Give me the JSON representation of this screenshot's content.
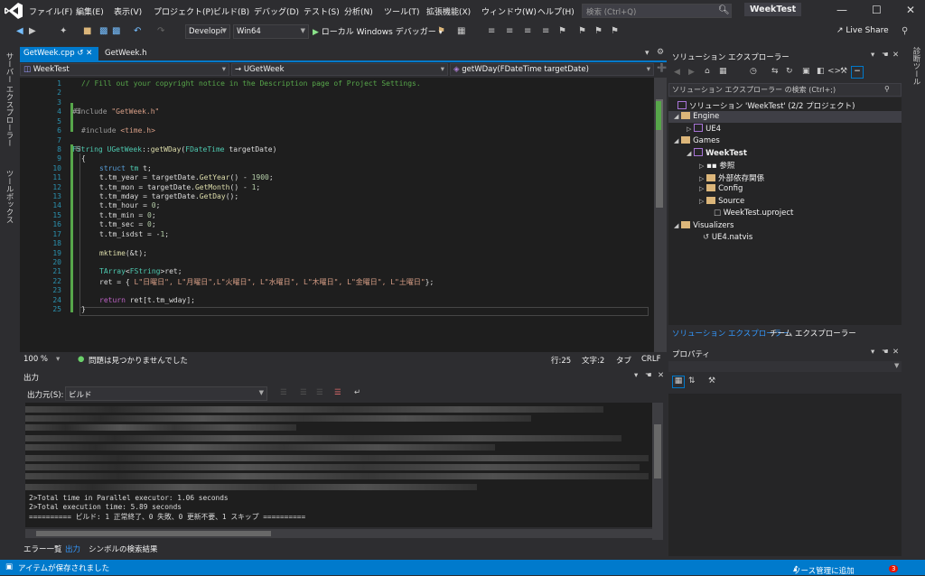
{
  "menu": {
    "items": [
      "ファイル(F)",
      "編集(E)",
      "表示(V)",
      "プロジェクト(P)",
      "ビルド(B)",
      "デバッグ(D)",
      "テスト(S)",
      "分析(N)",
      "ツール(T)",
      "拡張機能(X)",
      "ウィンドウ(W)",
      "ヘルプ(H)"
    ],
    "search_placeholder": "検索 (Ctrl+Q)",
    "solution_name": "WeekTest"
  },
  "toolbar": {
    "config": "Developi",
    "platform": "Win64",
    "run_label": "ローカル Windows デバッガー",
    "live_share": "Live Share"
  },
  "left_strip": {
    "server_explorer": "サーバー エクスプローラー",
    "toolbox": "ツールボックス"
  },
  "right_strip": {
    "diagnostic_tools": "診断ツール"
  },
  "editor": {
    "tabs": [
      "GetWeek.cpp",
      "GetWeek.h"
    ],
    "nav": {
      "project": "WeekTest",
      "class": "UGetWeek",
      "member": "getWDay(FDateTime targetDate)"
    },
    "line_numbers": [
      "1",
      "2",
      "3",
      "4",
      "5",
      "6",
      "7",
      "8",
      "9",
      "10",
      "11",
      "12",
      "13",
      "14",
      "15",
      "16",
      "17",
      "18",
      "19",
      "20",
      "21",
      "22",
      "23",
      "24",
      "25"
    ],
    "lines": {
      "l1": "// Fill out your copyright notice in the Description page of Project Settings.",
      "l4a": "#include ",
      "l4b": "\"GetWeek.h\"",
      "l6a": "#include ",
      "l6b": "<time.h>",
      "l8a": "FString ",
      "l8b": "UGetWeek",
      "l8c": "::",
      "l8d": "getWDay",
      "l8e": "(",
      "l8f": "FDateTime",
      "l8g": " targetDate)",
      "l9": "{",
      "l10a": "struct ",
      "l10b": "tm",
      "l10c": " t;",
      "l11a": "t.tm_year = targetDate.",
      "l11b": "GetYear",
      "l11c": "() - ",
      "l11d": "1900",
      "l11e": ";",
      "l12a": "t.tm_mon = targetDate.",
      "l12b": "GetMonth",
      "l12c": "() - ",
      "l12d": "1",
      "l12e": ";",
      "l13a": "t.tm_mday = targetDate.",
      "l13b": "GetDay",
      "l13c": "();",
      "l14a": "t.tm_hour = ",
      "l14b": "0",
      "l14c": ";",
      "l15a": "t.tm_min = ",
      "l15b": "0",
      "l15c": ";",
      "l16a": "t.tm_sec = ",
      "l16b": "0",
      "l16c": ";",
      "l17a": "t.tm_isdst = -",
      "l17b": "1",
      "l17c": ";",
      "l19a": "mktime",
      "l19b": "(&t);",
      "l21a": "TArray",
      "l21b": "<",
      "l21c": "FString",
      "l21d": ">ret;",
      "l22a": "ret = { ",
      "l22b": "L\"日曜日\", L\"月曜日\",L\"火曜日\", L\"水曜日\", L\"木曜日\", L\"金曜日\", L\"土曜日\"",
      "l22c": "};",
      "l24a": "return ",
      "l24b": "ret[t.tm_wday];",
      "l25": "}"
    },
    "status": {
      "zoom": "100 %",
      "issues": "問題は見つかりませんでした",
      "line": "行:25",
      "col": "文字:2",
      "tab": "タブ",
      "eol": "CRLF"
    }
  },
  "output": {
    "title": "出力",
    "source_label": "出力元(S):",
    "source_value": "ビルド",
    "lines": [
      "2>Total time in Parallel executor: 1.06 seconds",
      "2>Total execution time: 5.89 seconds",
      "========== ビルド: 1 正常終了、0 失敗、0 更新不要、1 スキップ =========="
    ],
    "tabs": [
      "エラー一覧",
      "出力",
      "シンボルの検索結果"
    ]
  },
  "solution_explorer": {
    "title": "ソリューション エクスプローラー",
    "search_placeholder": "ソリューション エクスプローラー の検索 (Ctrl+;)",
    "solution": "ソリューション 'WeekTest' (2/2 プロジェクト)",
    "tree": {
      "engine": "Engine",
      "ue4": "UE4",
      "games": "Games",
      "weektest": "WeekTest",
      "refs": "参照",
      "extdeps": "外部依存関係",
      "config": "Config",
      "source": "Source",
      "uproject": "WeekTest.uproject",
      "visualizers": "Visualizers",
      "natvis": "UE4.natvis"
    },
    "tabs": [
      "ソリューション エクスプローラー",
      "チーム エクスプローラー"
    ]
  },
  "properties": {
    "title": "プロパティ"
  },
  "statusbar": {
    "message": "アイテムが保存されました",
    "source_control": "ソース管理に追加",
    "notif_count": "3"
  },
  "colors": {
    "accent": "#007acc",
    "bg": "#2d2d30",
    "editor_bg": "#1e1e1e"
  }
}
